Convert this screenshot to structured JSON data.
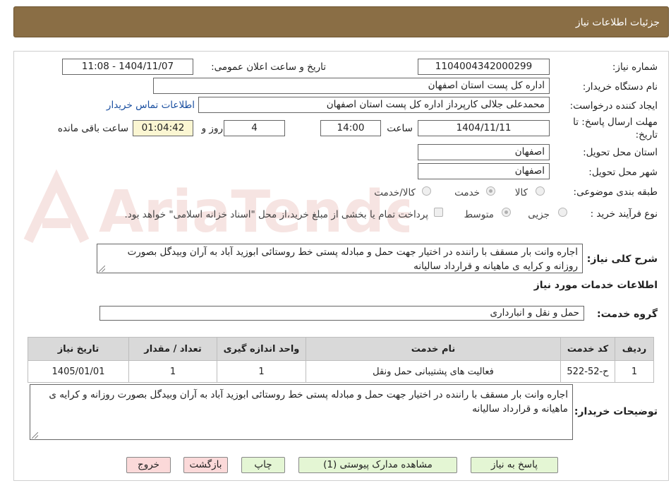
{
  "header": {
    "title": "جزئیات اطلاعات نیاز"
  },
  "form": {
    "need_number_label": "شماره نیاز:",
    "need_number": "1104004342000299",
    "announce_label": "تاریخ و ساعت اعلان عمومی:",
    "announce_value": "1404/11/07 - 11:08",
    "buyer_org_label": "نام دستگاه خریدار:",
    "buyer_org": "اداره کل پست استان اصفهان",
    "creator_label": "ایجاد کننده درخواست:",
    "creator": "محمدعلی جلالی کارپرداز اداره کل پست استان اصفهان",
    "contact_link": "اطلاعات تماس خریدار",
    "deadline_label_line1": "مهلت ارسال پاسخ: تا",
    "deadline_label_line2": "تاریخ:",
    "deadline_date": "1404/11/11",
    "time_label": "ساعت",
    "deadline_time": "14:00",
    "days_value": "4",
    "days_label": "روز و",
    "remaining_time": "01:04:42",
    "remaining_label": "ساعت باقی مانده",
    "province_label": "استان محل تحویل:",
    "province": "اصفهان",
    "city_label": "شهر محل تحویل:",
    "city": "اصفهان",
    "category_label": "طبقه بندی موضوعی:",
    "category_options": [
      "کالا",
      "خدمت",
      "کالا/خدمت"
    ],
    "category_selected": "خدمت",
    "process_label": "نوع فرآیند خرید :",
    "process_options": [
      "جزیی",
      "متوسط"
    ],
    "process_selected": "متوسط",
    "payment_note": "پرداخت تمام یا بخشی از مبلغ خرید،از محل \"اسناد خزانه اسلامی\" خواهد بود.",
    "summary_label": "شرح کلی نیاز:",
    "summary": "اجاره وانت بار مسقف با راننده در اختیار جهت حمل و مبادله پستی خط روستائی ابوزید آباد به آران وبیدگل بصورت روزانه و کرایه ی ماهیانه و قرارداد سالیانه"
  },
  "services": {
    "section_title": "اطلاعات خدمات مورد نیاز",
    "group_label": "گروه خدمت:",
    "group_value": "حمل و نقل و انبارداری",
    "columns": [
      "ردیف",
      "کد خدمت",
      "نام خدمت",
      "واحد اندازه گیری",
      "تعداد / مقدار",
      "تاریخ نیاز"
    ],
    "rows": [
      [
        "1",
        "ح-52-522",
        "فعالیت های پشتیبانی حمل ونقل",
        "1",
        "1",
        "1405/01/01"
      ]
    ]
  },
  "buyer_notes": {
    "label": "توضیحات خریدار:",
    "text": "اجاره وانت بار مسقف با راننده در اختیار جهت حمل و مبادله پستی خط روستائی ابوزید آباد به آران وبیدگل بصورت روزانه و کرایه ی ماهیانه و قرارداد سالیانه"
  },
  "buttons": {
    "reply": "پاسخ به نیاز",
    "attachments": "مشاهده مدارک پیوستی (1)",
    "print": "چاپ",
    "back": "بازگشت",
    "exit": "خروج"
  },
  "watermark": {
    "text": "AriaTender.neT",
    "color": "#c0392b"
  }
}
